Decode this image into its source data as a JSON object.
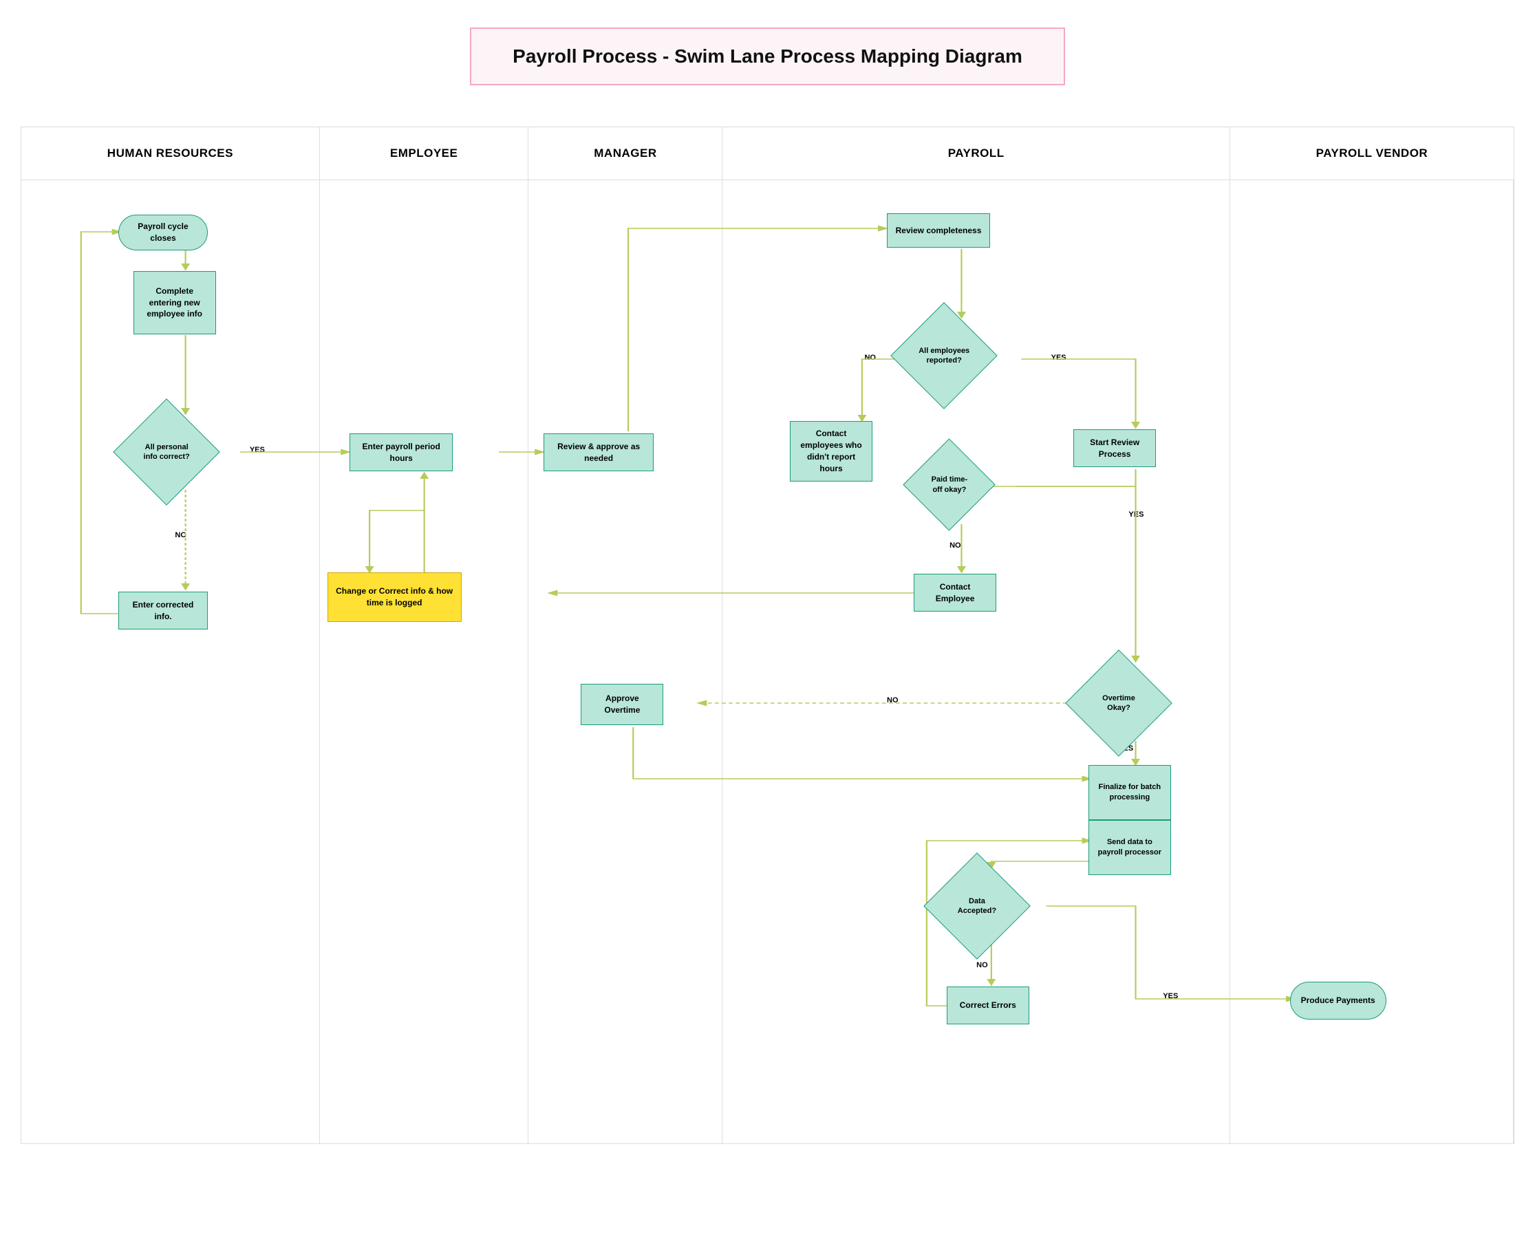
{
  "title": "Payroll Process - Swim Lane Process Mapping Diagram",
  "lanes": {
    "hr": "HUMAN RESOURCES",
    "emp": "EMPLOYEE",
    "mgr": "MANAGER",
    "pay": "PAYROLL",
    "ven": "PAYROLL VENDOR"
  },
  "nodes": {
    "payroll_cycle_closes": "Payroll cycle closes",
    "complete_entering": "Complete entering new employee info",
    "all_personal_info": "All personal info correct?",
    "enter_corrected": "Enter corrected info.",
    "enter_payroll_hours": "Enter payroll period hours",
    "review_approve": "Review & approve as needed",
    "change_correct": "Change or Correct info & how time is logged",
    "approve_overtime": "Approve Overtime",
    "review_completeness": "Review completeness",
    "all_emp_reported": "All employees reported?",
    "contact_emp_noreport": "Contact employees who didn't report hours",
    "start_review": "Start Review Process",
    "paid_timeoff": "Paid time-off okay?",
    "contact_employee": "Contact Employee",
    "overtime_okay": "Overtime Okay?",
    "finalize_batch": "Finalize for batch processing",
    "send_data": "Send data to payroll processor",
    "data_accepted": "Data Accepted?",
    "correct_errors": "Correct Errors",
    "produce_payments": "Produce Payments"
  },
  "labels": {
    "yes": "YES",
    "no": "NO"
  }
}
